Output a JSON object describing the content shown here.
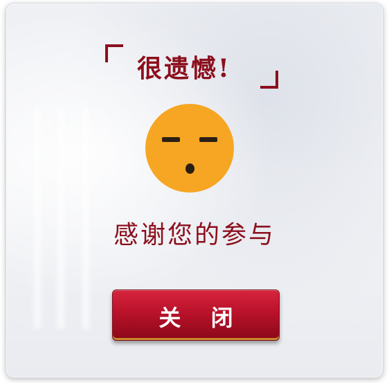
{
  "dialog": {
    "title": "很遗憾!",
    "message": "感谢您的参与",
    "close_label": "关 闭",
    "face_icon": "sad-face-icon",
    "colors": {
      "accent": "#8b0f1c",
      "button": "#b9122a",
      "face": "#f6a623"
    }
  }
}
